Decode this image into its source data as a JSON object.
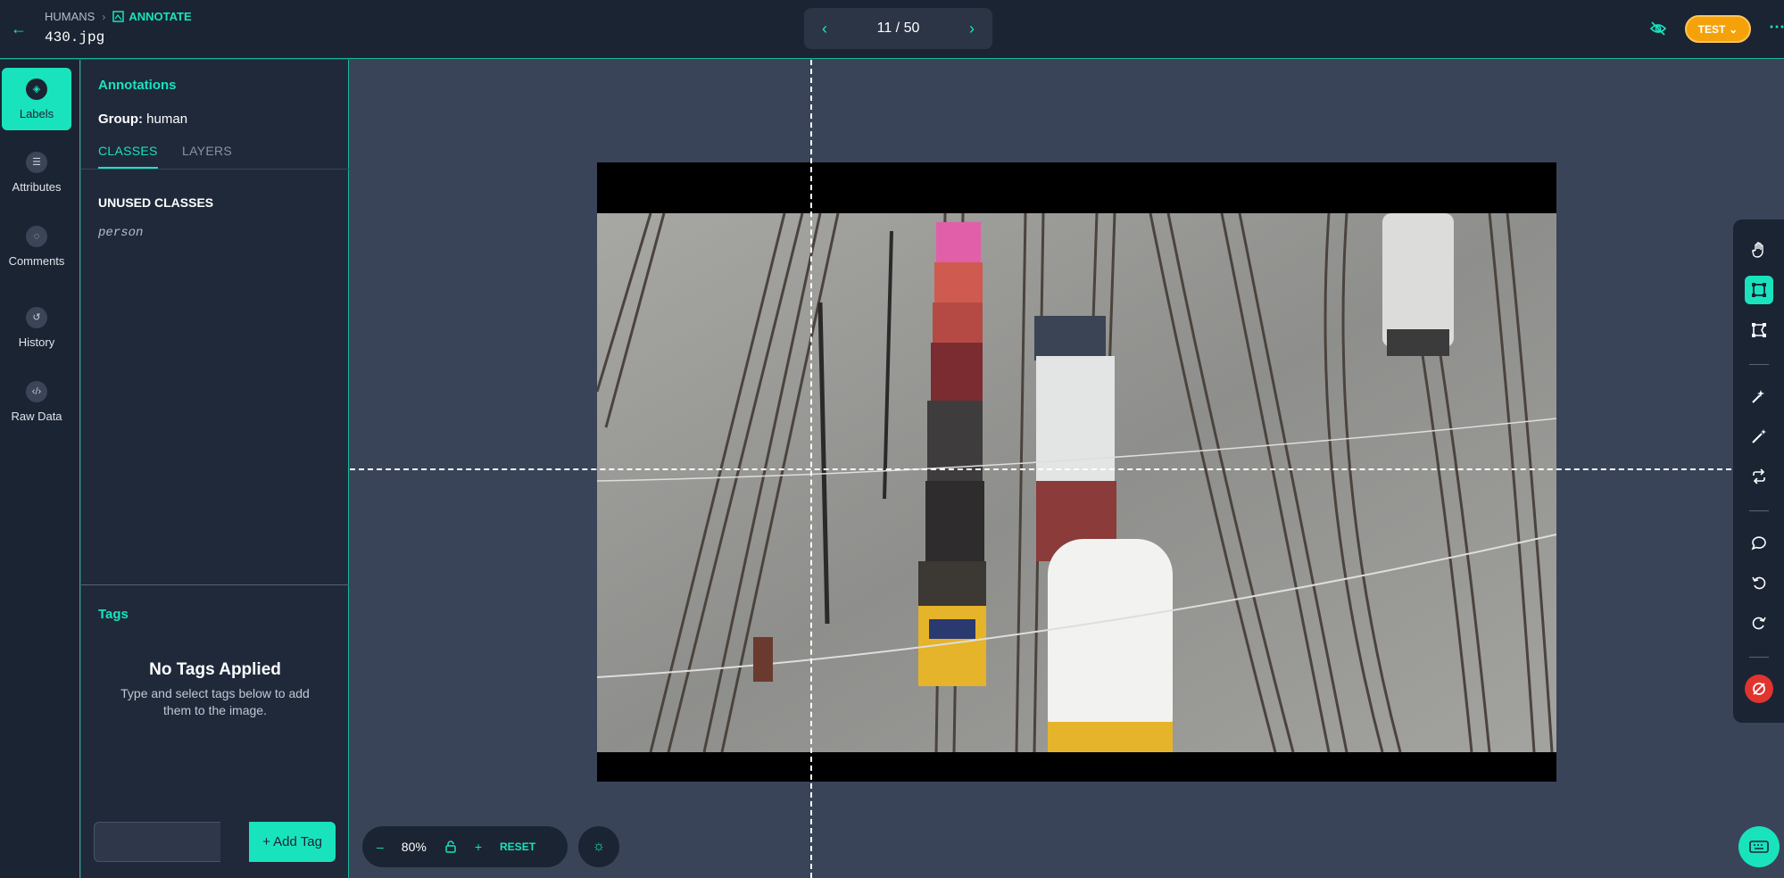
{
  "header": {
    "breadcrumb_root": "HUMANS",
    "breadcrumb_current": "ANNOTATE",
    "filename": "430.jpg",
    "pager": "11 / 50",
    "mode_button": "TEST"
  },
  "rail": {
    "items": [
      {
        "label": "Labels",
        "icon": "tag-icon"
      },
      {
        "label": "Attributes",
        "icon": "list-icon"
      },
      {
        "label": "Comments",
        "icon": "comment-icon"
      },
      {
        "label": "History",
        "icon": "history-icon"
      },
      {
        "label": "Raw Data",
        "icon": "code-icon"
      }
    ]
  },
  "panel": {
    "title": "Annotations",
    "group_label": "Group:",
    "group_value": "human",
    "tabs": [
      "CLASSES",
      "LAYERS"
    ],
    "unused_title": "UNUSED CLASSES",
    "unused_classes": [
      "person"
    ]
  },
  "tags": {
    "title": "Tags",
    "empty_title": "No Tags Applied",
    "empty_sub": "Type and select tags below to add them to the image.",
    "input_value": "",
    "add_label": "+ Add Tag"
  },
  "canvas": {
    "zoom_minus": "–",
    "zoom_level": "80%",
    "zoom_plus": "+",
    "reset_label": "RESET"
  },
  "colors": {
    "accent": "#19e3bd",
    "warning": "#f5a20a",
    "danger": "#e0342f",
    "header_bg": "#1b2433",
    "canvas_bg": "#3a4458"
  }
}
